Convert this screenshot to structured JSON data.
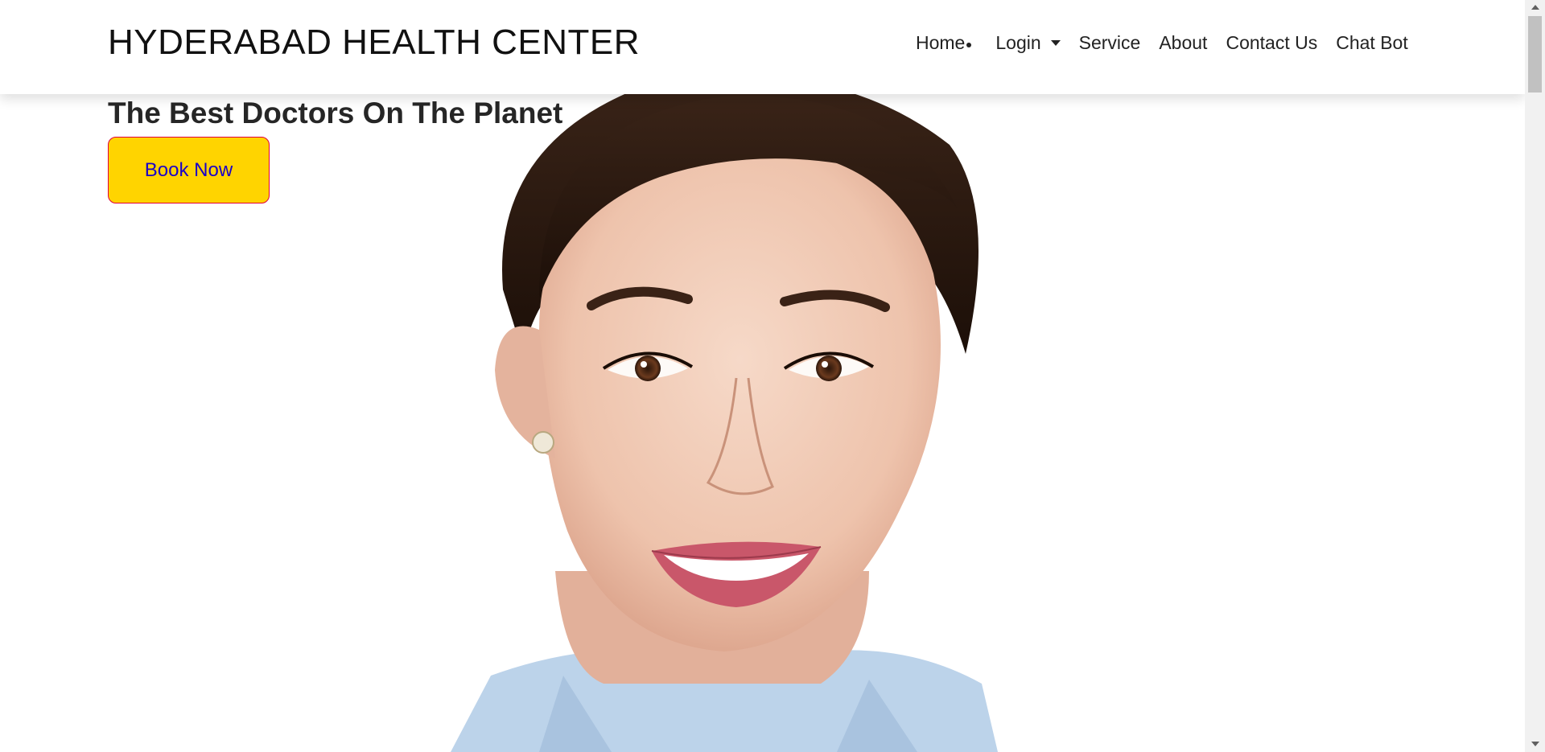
{
  "header": {
    "brand": "HYDERABAD HEALTH CENTER",
    "nav": {
      "home": "Home",
      "login": "Login",
      "service": "Service",
      "about": "About",
      "contact": "Contact Us",
      "chatbot": "Chat Bot"
    }
  },
  "hero": {
    "title": "The Best Doctors On The Planet",
    "button_label": "Book Now",
    "image_alt_icon": "doctor-portrait"
  },
  "colors": {
    "button_bg": "#ffd400",
    "button_border": "#e0003c",
    "button_text": "#1a00c8",
    "nav_text": "#222222"
  }
}
